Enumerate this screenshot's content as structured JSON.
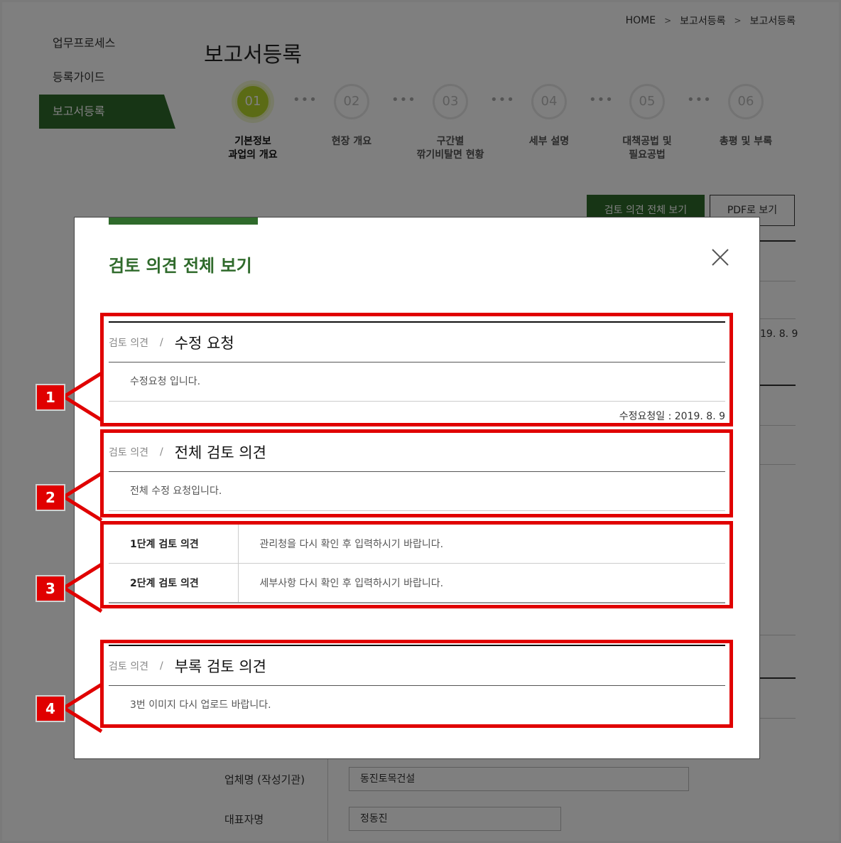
{
  "breadcrumb": {
    "items": [
      "HOME",
      "보고서등록",
      "보고서등록"
    ]
  },
  "sidebar": {
    "items": [
      {
        "label": "업무프로세스"
      },
      {
        "label": "등록가이드"
      },
      {
        "label": "보고서등록"
      }
    ]
  },
  "page": {
    "title": "보고서등록"
  },
  "steps": [
    {
      "num": "01",
      "label_l1": "기본정보",
      "label_l2": "과업의 개요"
    },
    {
      "num": "02",
      "label_l1": "현장 개요",
      "label_l2": ""
    },
    {
      "num": "03",
      "label_l1": "구간별",
      "label_l2": "깎기비탈면 현황"
    },
    {
      "num": "04",
      "label_l1": "세부 설명",
      "label_l2": ""
    },
    {
      "num": "05",
      "label_l1": "대책공법 및",
      "label_l2": "필요공법"
    },
    {
      "num": "06",
      "label_l1": "총평 및 부록",
      "label_l2": ""
    }
  ],
  "actions": {
    "review_all": "검토 의견 전체 보기",
    "pdf_view": "PDF로 보기"
  },
  "background": {
    "partial_date": "19. 8. 9"
  },
  "form": {
    "company_label": "업체명 (작성기관)",
    "company_value": "동진토목건설",
    "ceo_label": "대표자명",
    "ceo_value": "정동진"
  },
  "modal": {
    "title": "검토 의견 전체 보기",
    "cards": [
      {
        "prefix": "검토 의견",
        "title": "수정 요청",
        "body": "수정요청 입니다.",
        "foot": "수정요청일 : 2019. 8. 9"
      },
      {
        "prefix": "검토 의견",
        "title": "전체 검토 의견",
        "body": "전체 수정 요청입니다."
      },
      {
        "prefix": "검토 의견",
        "title": "부록 검토 의견",
        "body": "3번 이미지 다시 업로드 바랍니다."
      }
    ],
    "stages": [
      {
        "label": "1단계 검토 의견",
        "text": "관리청을 다시 확인 후 입력하시기 바랍니다."
      },
      {
        "label": "2단계 검토 의견",
        "text": "세부사항 다시 확인 후 입력하시기 바랍니다."
      }
    ]
  },
  "annotations": [
    "1",
    "2",
    "3",
    "4"
  ],
  "colors": {
    "accent_green": "#2f6a2b",
    "step_active": "#b6d62a",
    "annotation_red": "#e00000"
  }
}
